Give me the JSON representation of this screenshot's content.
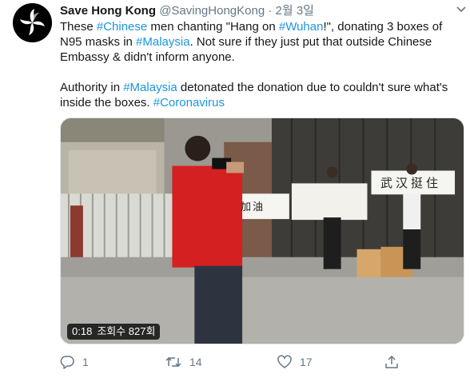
{
  "tweet": {
    "display_name": "Save Hong Kong",
    "handle": "@SavingHongKong",
    "separator": "·",
    "date": "2월 3일",
    "para1": [
      {
        "text": "These ",
        "tag": false
      },
      {
        "text": "#Chinese",
        "tag": true
      },
      {
        "text": " men chanting \"Hang on ",
        "tag": false
      },
      {
        "text": "#Wuhan",
        "tag": true
      },
      {
        "text": "!\", donating 3 boxes of N95 masks in ",
        "tag": false
      },
      {
        "text": "#Malaysia",
        "tag": true
      },
      {
        "text": ". Not sure if they just put that outside Chinese Embassy & didn't inform anyone.",
        "tag": false
      }
    ],
    "para2": [
      {
        "text": "Authority in ",
        "tag": false
      },
      {
        "text": "#Malaysia",
        "tag": true
      },
      {
        "text": " detonated the donation due to couldn't sure what's inside the boxes. ",
        "tag": false
      },
      {
        "text": "#Coronavirus",
        "tag": true
      }
    ]
  },
  "video": {
    "duration": "0:18",
    "views": "조회수 827회",
    "sign_left": "加油",
    "sign_right": "武汉挺住"
  },
  "actions": {
    "reply_count": "1",
    "retweet_count": "14",
    "like_count": "17"
  },
  "colors": {
    "link": "#1b95e0",
    "secondary": "#657786"
  }
}
